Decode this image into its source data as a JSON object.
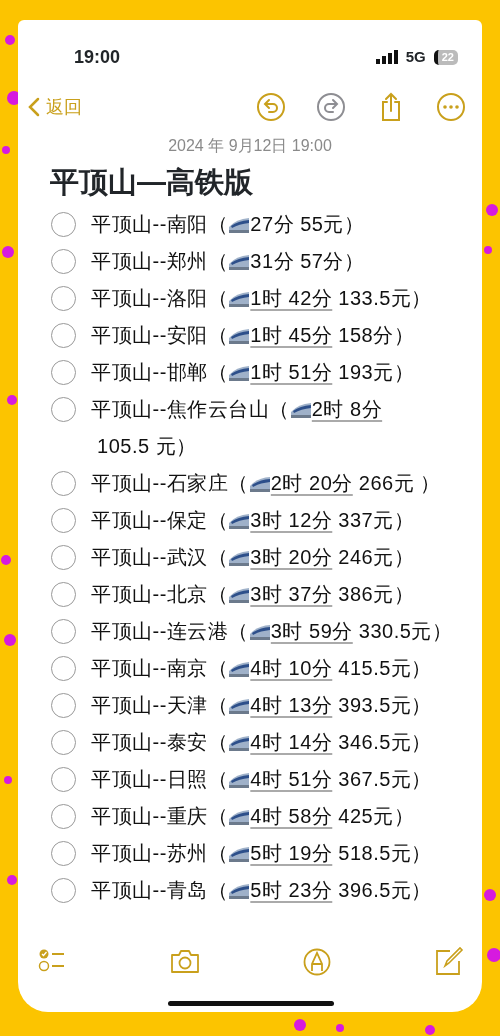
{
  "status_bar": {
    "time": "19:00",
    "network": "5G",
    "battery": "22"
  },
  "nav": {
    "back": "返回",
    "actions": [
      {
        "kind": "undo",
        "disabled": false
      },
      {
        "kind": "redo",
        "disabled": true
      },
      {
        "kind": "share",
        "disabled": false
      },
      {
        "kind": "more",
        "disabled": false
      }
    ]
  },
  "note": {
    "date": "2024 年 9月12日 19:00",
    "title": "平顶山—高铁版",
    "items": [
      {
        "route": "平顶山--南阳（",
        "duration": "27分",
        "price": " 55元）",
        "linked": false,
        "checked": false
      },
      {
        "route": "平顶山--郑州（",
        "duration": "31分",
        "price": " 57分）",
        "linked": false,
        "checked": false
      },
      {
        "route": "平顶山--洛阳（",
        "duration": "1时 42分",
        "price": " 133.5元）",
        "linked": true,
        "checked": false
      },
      {
        "route": "平顶山--安阳（",
        "duration": "1时 45分",
        "price": " 158分）",
        "linked": true,
        "checked": false
      },
      {
        "route": "平顶山--邯郸（",
        "duration": "1时 51分",
        "price": " 193元）",
        "linked": true,
        "checked": false
      },
      {
        "route": "平顶山--焦作云台山（",
        "duration": "2时 8分",
        "price": " 105.5 元）",
        "linked": true,
        "checked": false
      },
      {
        "route": "平顶山--石家庄（",
        "duration": "2时 20分",
        "price": " 266元 ）",
        "linked": true,
        "checked": false
      },
      {
        "route": "平顶山--保定（",
        "duration": "3时 12分",
        "price": " 337元）",
        "linked": true,
        "checked": false
      },
      {
        "route": "平顶山--武汉（",
        "duration": "3时 20分",
        "price": " 246元）",
        "linked": true,
        "checked": false
      },
      {
        "route": "平顶山--北京（",
        "duration": "3时 37分",
        "price": " 386元）",
        "linked": true,
        "checked": false
      },
      {
        "route": "平顶山--连云港（",
        "duration": "3时 59分",
        "price": " 330.5元）",
        "linked": true,
        "checked": false
      },
      {
        "route": "平顶山--南京（",
        "duration": "4时 10分",
        "price": " 415.5元）",
        "linked": true,
        "checked": false
      },
      {
        "route": "平顶山--天津（",
        "duration": "4时 13分",
        "price": " 393.5元）",
        "linked": true,
        "checked": false
      },
      {
        "route": "平顶山--泰安（",
        "duration": "4时 14分",
        "price": " 346.5元）",
        "linked": true,
        "checked": false
      },
      {
        "route": "平顶山--日照（",
        "duration": "4时 51分",
        "price": " 367.5元）",
        "linked": true,
        "checked": false
      },
      {
        "route": "平顶山--重庆（",
        "duration": "4时 58分",
        "price": " 425元）",
        "linked": true,
        "checked": false
      },
      {
        "route": "平顶山--苏州（",
        "duration": "5时 19分",
        "price": " 518.5元）",
        "linked": true,
        "checked": false
      },
      {
        "route": "平顶山--青岛（",
        "duration": "5时 23分",
        "price": " 396.5元）",
        "linked": true,
        "checked": false
      }
    ]
  },
  "toolbar": [
    {
      "kind": "checklist"
    },
    {
      "kind": "camera"
    },
    {
      "kind": "markup"
    },
    {
      "kind": "compose"
    }
  ]
}
